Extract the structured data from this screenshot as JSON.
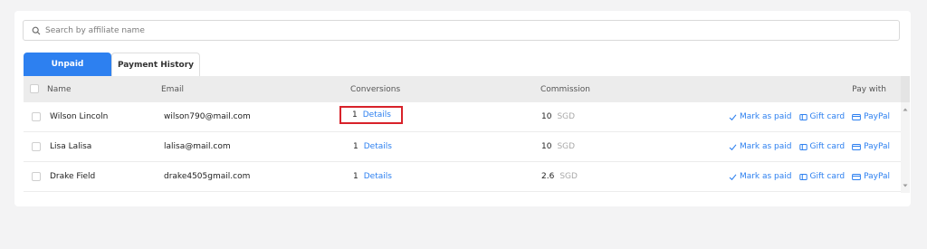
{
  "search": {
    "placeholder": "Search by affiliate name",
    "icon": "search-icon"
  },
  "tabs": [
    {
      "label": "Unpaid",
      "active": true
    },
    {
      "label": "Payment History",
      "active": false
    }
  ],
  "table": {
    "headers": {
      "name": "Name",
      "email": "Email",
      "conversions": "Conversions",
      "commission": "Commission",
      "pay_with": "Pay with"
    },
    "rows": [
      {
        "name": "Wilson Lincoln",
        "email": "wilson790@mail.com",
        "conversions": "1",
        "details": "Details",
        "commission": "10",
        "currency": "SGD",
        "highlighted": true
      },
      {
        "name": "Lisa Lalisa",
        "email": "lalisa@mail.com",
        "conversions": "1",
        "details": "Details",
        "commission": "10",
        "currency": "SGD",
        "highlighted": false
      },
      {
        "name": "Drake Field",
        "email": "drake4505gmail.com",
        "conversions": "1",
        "details": "Details",
        "commission": "2.6",
        "currency": "SGD",
        "highlighted": false
      }
    ],
    "actions": {
      "mark_paid": "Mark as paid",
      "gift_card": "Gift card",
      "paypal": "PayPal"
    }
  },
  "colors": {
    "accent": "#2d80f0",
    "highlight": "#d8222a"
  }
}
